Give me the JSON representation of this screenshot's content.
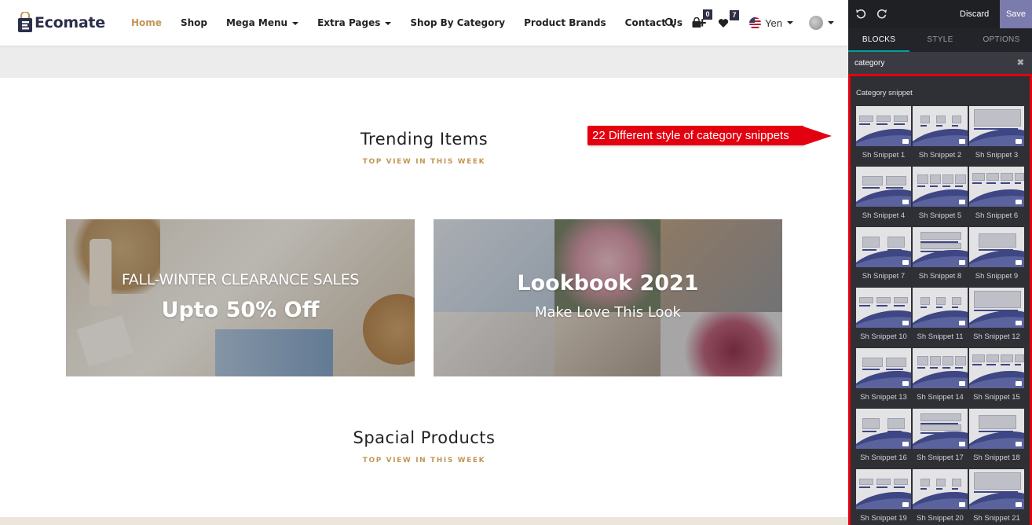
{
  "brand": {
    "name": "Ecomate",
    "accent": "#c39655",
    "dark": "#2b2f4a"
  },
  "nav": {
    "items": [
      {
        "label": "Home",
        "active": true,
        "dropdown": false
      },
      {
        "label": "Shop",
        "active": false,
        "dropdown": false
      },
      {
        "label": "Mega Menu",
        "active": false,
        "dropdown": true
      },
      {
        "label": "Extra Pages",
        "active": false,
        "dropdown": true
      },
      {
        "label": "Shop By Category",
        "active": false,
        "dropdown": false
      },
      {
        "label": "Product Brands",
        "active": false,
        "dropdown": false
      },
      {
        "label": "Contact Us",
        "active": false,
        "dropdown": false
      }
    ],
    "plus_label": "+",
    "cart_count": "0",
    "wishlist_count": "7",
    "currency": "Yen"
  },
  "sections": {
    "trending": {
      "title": "Trending Items",
      "subtitle": "TOP VIEW IN THIS WEEK"
    },
    "special": {
      "title": "Spacial Products",
      "subtitle": "TOP VIEW IN THIS WEEK"
    }
  },
  "banners": [
    {
      "line1": "FALL-WINTER CLEARANCE SALES",
      "line2": "Upto 50% Off"
    },
    {
      "line1": "Lookbook 2021",
      "line2": "Make Love This Look"
    }
  ],
  "editor": {
    "discard_label": "Discard",
    "save_label": "Save",
    "save_color": "#7c7bad",
    "tabs": [
      {
        "label": "BLOCKS",
        "active": true
      },
      {
        "label": "STYLE",
        "active": false
      },
      {
        "label": "OPTIONS",
        "active": false
      }
    ],
    "search_value": "category",
    "clear_label": "✖",
    "snippet_heading": "Category snippet",
    "snippets": [
      "Sh Snippet 1",
      "Sh Snippet 2",
      "Sh Snippet 3",
      "Sh Snippet 4",
      "Sh Snippet 5",
      "Sh Snippet 6",
      "Sh Snippet 7",
      "Sh Snippet 8",
      "Sh Snippet 9",
      "Sh Snippet 10",
      "Sh Snippet 11",
      "Sh Snippet 12",
      "Sh Snippet 13",
      "Sh Snippet 14",
      "Sh Snippet 15",
      "Sh Snippet 16",
      "Sh Snippet 17",
      "Sh Snippet 18",
      "Sh Snippet 19",
      "Sh Snippet 20",
      "Sh Snippet 21"
    ]
  },
  "annotation": {
    "text": "22 Different style of category snippets",
    "color": "#e3000f"
  }
}
